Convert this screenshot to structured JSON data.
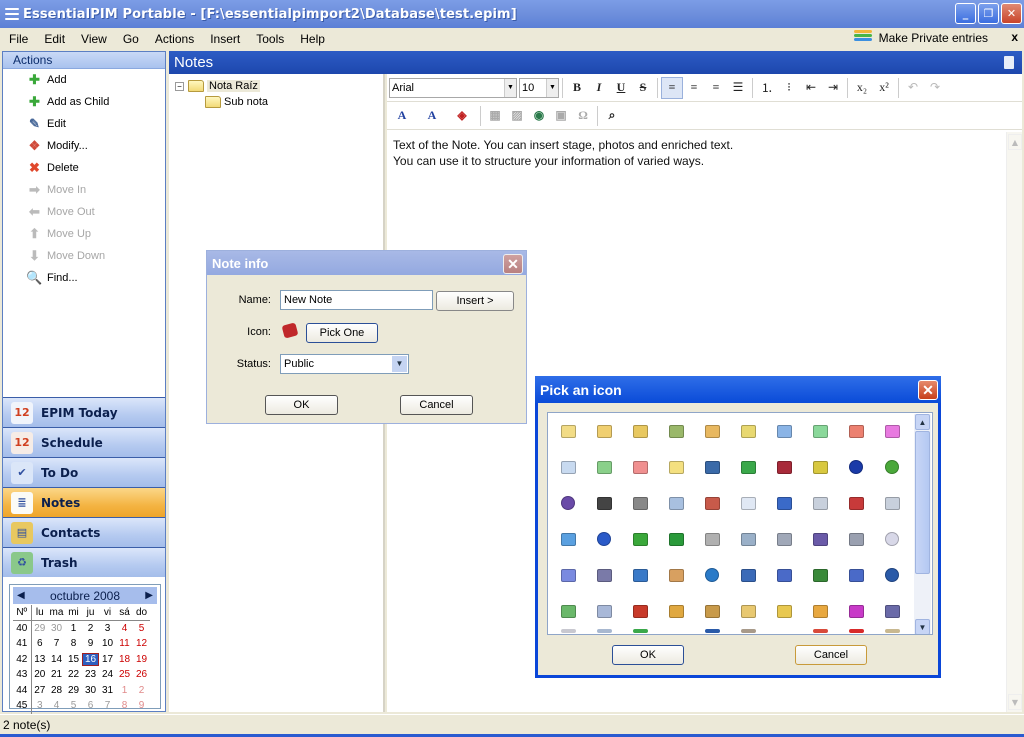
{
  "window": {
    "title": "EssentialPIM Portable - [F:\\essentialpimport2\\Database\\test.epim]",
    "minimize": "_",
    "restore": "❐",
    "close": "✕"
  },
  "menu": {
    "items": [
      "File",
      "Edit",
      "View",
      "Go",
      "Actions",
      "Insert",
      "Tools",
      "Help"
    ],
    "private_label": "Make Private entries",
    "private_close": "x",
    "private_colors": [
      "#f2b53a",
      "#49b548",
      "#3b8fe0"
    ]
  },
  "actions": {
    "header": "Actions",
    "items": [
      {
        "label": "Add",
        "icon": "plus-icon",
        "glyph": "✚",
        "color": "#3aa83a",
        "enabled": true
      },
      {
        "label": "Add as Child",
        "icon": "plus-icon",
        "glyph": "✚",
        "color": "#3aa83a",
        "enabled": true
      },
      {
        "label": "Edit",
        "icon": "edit-note-icon",
        "glyph": "✎",
        "color": "#4a6a9a",
        "enabled": true
      },
      {
        "label": "Modify...",
        "icon": "modify-icon",
        "glyph": "❖",
        "color": "#d04a3a",
        "enabled": true
      },
      {
        "label": "Delete",
        "icon": "delete-icon",
        "glyph": "✖",
        "color": "#e0482c",
        "enabled": true
      },
      {
        "label": "Move In",
        "icon": "arrow-right-icon",
        "glyph": "➡",
        "color": "#bbbbbb",
        "enabled": false
      },
      {
        "label": "Move Out",
        "icon": "arrow-left-icon",
        "glyph": "⬅",
        "color": "#bbbbbb",
        "enabled": false
      },
      {
        "label": "Move Up",
        "icon": "arrow-up-icon",
        "glyph": "⬆",
        "color": "#bbbbbb",
        "enabled": false
      },
      {
        "label": "Move Down",
        "icon": "arrow-down-icon",
        "glyph": "⬇",
        "color": "#bbbbbb",
        "enabled": false
      },
      {
        "label": "Find...",
        "icon": "magnifier-icon",
        "glyph": "🔍",
        "color": "#3a7ad0",
        "enabled": true
      }
    ]
  },
  "nav": {
    "items": [
      {
        "label": "EPIM Today",
        "icon": "today-icon",
        "glyph": "12",
        "active": false
      },
      {
        "label": "Schedule",
        "icon": "calendar-icon",
        "glyph": "12",
        "active": false
      },
      {
        "label": "To Do",
        "icon": "todo-icon",
        "glyph": "✔",
        "active": false
      },
      {
        "label": "Notes",
        "icon": "notes-icon",
        "glyph": "≣",
        "active": true
      },
      {
        "label": "Contacts",
        "icon": "contacts-icon",
        "glyph": "▤",
        "active": false
      },
      {
        "label": "Trash",
        "icon": "trash-icon",
        "glyph": "♻",
        "active": false
      }
    ]
  },
  "calendar": {
    "month_label": "octubre  2008",
    "prev": "◀",
    "next": "▶",
    "headers": [
      "Nº",
      "lu",
      "ma",
      "mi",
      "ju",
      "vi",
      "sá",
      "do"
    ],
    "weeks": [
      {
        "wk": "40",
        "days": [
          "29",
          "30",
          "1",
          "2",
          "3",
          "4",
          "5"
        ],
        "cls": [
          "gray",
          "gray",
          "",
          "",
          "",
          "red",
          "red"
        ]
      },
      {
        "wk": "41",
        "days": [
          "6",
          "7",
          "8",
          "9",
          "10",
          "11",
          "12"
        ],
        "cls": [
          "",
          "",
          "",
          "",
          "",
          "red",
          "red"
        ]
      },
      {
        "wk": "42",
        "days": [
          "13",
          "14",
          "15",
          "16",
          "17",
          "18",
          "19"
        ],
        "cls": [
          "",
          "",
          "",
          "today",
          "",
          "red",
          "red"
        ]
      },
      {
        "wk": "43",
        "days": [
          "20",
          "21",
          "22",
          "23",
          "24",
          "25",
          "26"
        ],
        "cls": [
          "",
          "",
          "",
          "",
          "",
          "red",
          "red"
        ]
      },
      {
        "wk": "44",
        "days": [
          "27",
          "28",
          "29",
          "30",
          "31",
          "1",
          "2"
        ],
        "cls": [
          "",
          "",
          "",
          "",
          "",
          "pink",
          "pink"
        ]
      },
      {
        "wk": "45",
        "days": [
          "3",
          "4",
          "5",
          "6",
          "7",
          "8",
          "9"
        ],
        "cls": [
          "gray",
          "gray",
          "gray",
          "gray",
          "gray",
          "pink",
          "pink"
        ]
      }
    ],
    "selected_day": "16"
  },
  "notes": {
    "header": "Notes",
    "tree": [
      {
        "label": "Nota Raíz",
        "expander": "−"
      },
      {
        "label": "Sub nota"
      }
    ],
    "editor": {
      "font": "Arial",
      "size": "10",
      "lines": [
        "Text of the Note. You can insert stage, photos and enriched text.",
        "You can use it to structure your information of varied ways."
      ]
    }
  },
  "toolbar": {
    "format": [
      {
        "name": "bold-button",
        "glyph": "B",
        "style": "font-weight:bold"
      },
      {
        "name": "italic-button",
        "glyph": "I",
        "style": "font-style:italic;font-weight:bold"
      },
      {
        "name": "underline-button",
        "glyph": "U",
        "style": "text-decoration:underline;font-weight:bold"
      },
      {
        "name": "strikethrough-button",
        "glyph": "S",
        "style": "text-decoration:line-through;font-weight:bold"
      }
    ],
    "align": [
      {
        "name": "align-left-button",
        "glyph": "≡",
        "selected": true
      },
      {
        "name": "align-center-button",
        "glyph": "≡",
        "selected": false
      },
      {
        "name": "align-right-button",
        "glyph": "≡",
        "selected": false
      },
      {
        "name": "justify-button",
        "glyph": "☰",
        "selected": false
      }
    ],
    "lists": [
      {
        "name": "numbered-list-button",
        "glyph": "⒈"
      },
      {
        "name": "bullet-list-button",
        "glyph": "⁝"
      },
      {
        "name": "outdent-button",
        "glyph": "⇤"
      },
      {
        "name": "indent-button",
        "glyph": "⇥"
      }
    ],
    "script": [
      {
        "name": "subscript-button",
        "glyph": "x₂"
      },
      {
        "name": "superscript-button",
        "glyph": "x²"
      }
    ],
    "history": [
      {
        "name": "undo-button",
        "glyph": "↶"
      },
      {
        "name": "redo-button",
        "glyph": "↷"
      }
    ],
    "row2": [
      {
        "name": "text-color-button",
        "glyph": "A",
        "color": "#2040a0"
      },
      {
        "name": "highlight-color-button",
        "glyph": "A",
        "color": "#2040a0"
      },
      {
        "name": "fill-color-button",
        "glyph": "◈",
        "color": "#c02020"
      },
      {
        "name": "insert-table-button",
        "glyph": "▦",
        "color": "#aaaaaa"
      },
      {
        "name": "insert-image-button",
        "glyph": "▨",
        "color": "#aaaaaa"
      },
      {
        "name": "insert-link-button",
        "glyph": "◉",
        "color": "#2a7a4a"
      },
      {
        "name": "insert-field-button",
        "glyph": "▣",
        "color": "#aaaaaa"
      },
      {
        "name": "insert-symbol-button",
        "glyph": "Ω",
        "color": "#aaaaaa"
      },
      {
        "name": "find-button",
        "glyph": "⌕",
        "color": "#222222"
      }
    ]
  },
  "note_info": {
    "title": "Note info",
    "name_label": "Name:",
    "name_value": "New Note",
    "insert_label": "Insert >",
    "icon_label": "Icon:",
    "pick_label": "Pick One",
    "status_label": "Status:",
    "status_value": "Public",
    "ok": "OK",
    "cancel": "Cancel"
  },
  "icon_picker": {
    "title": "Pick an icon",
    "ok": "OK",
    "cancel": "Cancel",
    "rows": [
      [
        {
          "n": "folder-yellow-icon",
          "c": "#f2dc86"
        },
        {
          "n": "folder-open-icon",
          "c": "#f0cf70"
        },
        {
          "n": "folder-check-icon",
          "c": "#e8c860"
        },
        {
          "n": "folder-arrow-icon",
          "c": "#9ab86a"
        },
        {
          "n": "folder-tools-icon",
          "c": "#e8b860"
        },
        {
          "n": "folder-lightning-icon",
          "c": "#e8d870"
        },
        {
          "n": "folder-blue-icon",
          "c": "#8ab4e6"
        },
        {
          "n": "folder-green-icon",
          "c": "#8ad89a"
        },
        {
          "n": "folder-red-icon",
          "c": "#ec8070"
        },
        {
          "n": "folder-pink-icon",
          "c": "#e87ae0"
        }
      ],
      [
        {
          "n": "note-blue-icon",
          "c": "#c8daf0"
        },
        {
          "n": "note-green-icon",
          "c": "#8ad08a"
        },
        {
          "n": "note-red-icon",
          "c": "#f09090"
        },
        {
          "n": "note-yellow-icon",
          "c": "#f4e080"
        },
        {
          "n": "list-blue-icon",
          "c": "#3a6aa8"
        },
        {
          "n": "list-green-icon",
          "c": "#3aa84a"
        },
        {
          "n": "list-red-icon",
          "c": "#a82a3a"
        },
        {
          "n": "list-yellow-icon",
          "c": "#d8c840"
        },
        {
          "n": "book-blue-icon",
          "c": "#1a3aa8"
        },
        {
          "n": "book-green-icon",
          "c": "#4aa83a"
        }
      ],
      [
        {
          "n": "book-purple-icon",
          "c": "#6a4aa8"
        },
        {
          "n": "open-book-icon",
          "c": "#444444"
        },
        {
          "n": "paperclip-icon",
          "c": "#888888"
        },
        {
          "n": "doc-search-icon",
          "c": "#a8c0e0"
        },
        {
          "n": "doc-check-icon",
          "c": "#c85a4a"
        },
        {
          "n": "doc-red-check-icon",
          "c": "#e0e8f4"
        },
        {
          "n": "doc-question-icon",
          "c": "#3a6ac8"
        },
        {
          "n": "doc-clock-icon",
          "c": "#c8d0dc"
        },
        {
          "n": "doc-font-icon",
          "c": "#c83a3a"
        },
        {
          "n": "doc-music-icon",
          "c": "#c8d0dc"
        }
      ],
      [
        {
          "n": "keyboard-icon",
          "c": "#5aa0e0"
        },
        {
          "n": "help-icon",
          "c": "#2a5ac8"
        },
        {
          "n": "green-arrow-icon",
          "c": "#3aa83a"
        },
        {
          "n": "arrow-box-icon",
          "c": "#2a9a3a"
        },
        {
          "n": "drive-icon",
          "c": "#b0b0b0"
        },
        {
          "n": "printer-icon",
          "c": "#9ab0c8"
        },
        {
          "n": "scanner-icon",
          "c": "#a0a8b8"
        },
        {
          "n": "floppy-icon",
          "c": "#6a5aa8"
        },
        {
          "n": "user-icon",
          "c": "#9aa0b0"
        },
        {
          "n": "cd-icon",
          "c": "#d8d8e8"
        }
      ],
      [
        {
          "n": "bowl-icon",
          "c": "#7a8ae0"
        },
        {
          "n": "gear-icon",
          "c": "#7a7aa8"
        },
        {
          "n": "info-icon",
          "c": "#3a7ac8"
        },
        {
          "n": "magnifier-icon",
          "c": "#d8a060"
        },
        {
          "n": "globe-icon",
          "c": "#2a7ac8"
        },
        {
          "n": "ie-icon",
          "c": "#3a6ab8"
        },
        {
          "n": "card-icon",
          "c": "#4a6ac8"
        },
        {
          "n": "windows-icon",
          "c": "#3a8a3a"
        },
        {
          "n": "doc-edit-icon",
          "c": "#4a6ac8"
        },
        {
          "n": "power-icon",
          "c": "#2a5aa8"
        }
      ],
      [
        {
          "n": "recycle-icon",
          "c": "#6ab86a"
        },
        {
          "n": "mail-icon",
          "c": "#a8b8d8"
        },
        {
          "n": "photo-icon",
          "c": "#c83a2a"
        },
        {
          "n": "key-icon",
          "c": "#e0a840"
        },
        {
          "n": "phone-icon",
          "c": "#c89a4a"
        },
        {
          "n": "folder-table-icon",
          "c": "#e8c870"
        },
        {
          "n": "lock-icon",
          "c": "#e8c850"
        },
        {
          "n": "doc-add-icon",
          "c": "#e8a840"
        },
        {
          "n": "cubes-icon",
          "c": "#c83ac8"
        },
        {
          "n": "music-icon",
          "c": "#6a6aa8"
        }
      ]
    ]
  },
  "status": {
    "text": "2 note(s)"
  }
}
